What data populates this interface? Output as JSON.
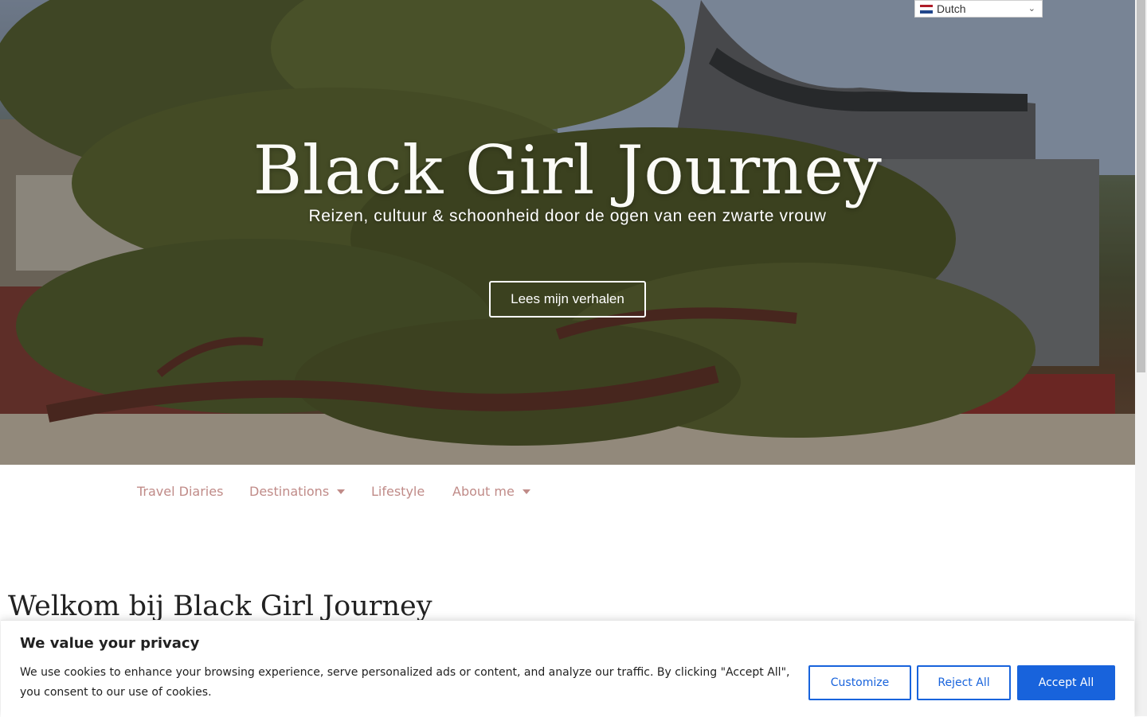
{
  "language_selector": {
    "label": "Dutch",
    "flag_colors": [
      "#ae1c28",
      "#ffffff",
      "#21468b"
    ]
  },
  "hero": {
    "title": "Black Girl Journey",
    "subtitle": "Reizen, cultuur & schoonheid door de ogen van een zwarte vrouw",
    "button_label": "Lees mijn verhalen"
  },
  "nav": {
    "items": [
      {
        "label": "Travel Diaries",
        "has_dropdown": false
      },
      {
        "label": "Destinations",
        "has_dropdown": true
      },
      {
        "label": "Lifestyle",
        "has_dropdown": false
      },
      {
        "label": "About me",
        "has_dropdown": true
      }
    ],
    "color": "#c08b88"
  },
  "main": {
    "heading": "Welkom bij Black Girl Journey"
  },
  "cookie_banner": {
    "title": "We value your privacy",
    "text": "We use cookies to enhance your browsing experience, serve personalized ads or content, and analyze our traffic. By clicking \"Accept All\", you consent to our use of cookies.",
    "customize_label": "Customize",
    "reject_label": "Reject All",
    "accept_label": "Accept All",
    "accent": "#1863dc"
  }
}
